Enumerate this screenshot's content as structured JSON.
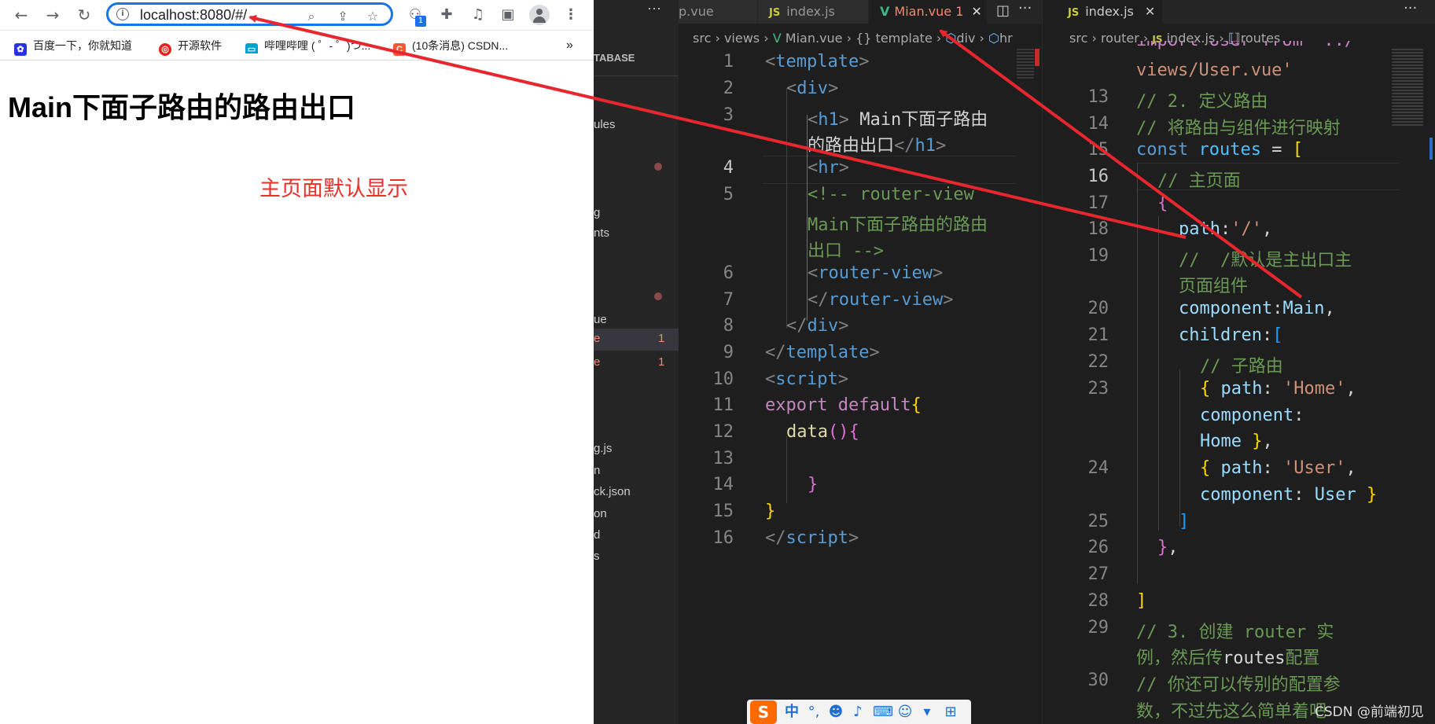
{
  "browser": {
    "url": "localhost:8080/#/",
    "bookmarks": [
      {
        "label": "百度一下，你就知道",
        "icon": "baidu-paw-icon",
        "color": "#2932e1"
      },
      {
        "label": "开源软件",
        "icon": "oschina-icon",
        "color": "#e2231a"
      },
      {
        "label": "哔哩哔哩 ( ゜- ゜)つ...",
        "icon": "bilibili-tv-icon",
        "color": "#00a1d6"
      },
      {
        "label": "(10条消息) CSDN...",
        "icon": "csdn-c-icon",
        "color": "#fc5531"
      }
    ],
    "more_bookmarks": "»",
    "extension_badge": "1",
    "page": {
      "heading": "Main下面子路由的路由出口",
      "default_text": "主页面默认显示"
    }
  },
  "explorer": {
    "header": "TABASE",
    "items": [
      {
        "label": "ules",
        "y": 0
      },
      {
        "label": "g",
        "y": 1
      },
      {
        "label": "nts",
        "y": 2
      },
      {
        "label": "ue",
        "y": 3
      },
      {
        "label": "e",
        "y": 4,
        "badge": "1"
      },
      {
        "label": "e",
        "y": 5,
        "badge": "1"
      },
      {
        "label": "g.js",
        "y": 6
      },
      {
        "label": "n",
        "y": 7
      },
      {
        "label": "ck.json",
        "y": 8
      },
      {
        "label": "on",
        "y": 9
      },
      {
        "label": "d",
        "y": 10
      },
      {
        "label": "s",
        "y": 11
      }
    ]
  },
  "editor1": {
    "tabs": [
      {
        "label": "p.vue"
      },
      {
        "label": "index.js",
        "icon": "JS"
      },
      {
        "label": "Mian.vue 1",
        "icon": "V",
        "active": true
      }
    ],
    "breadcrumb": [
      "src",
      "views",
      "Mian.vue",
      "template",
      "div",
      "hr"
    ],
    "lines": [
      {
        "n": "1"
      },
      {
        "n": "2"
      },
      {
        "n": "3"
      },
      {
        "n": ""
      },
      {
        "n": "4"
      },
      {
        "n": "5"
      },
      {
        "n": ""
      },
      {
        "n": ""
      },
      {
        "n": "6"
      },
      {
        "n": "7"
      },
      {
        "n": "8"
      },
      {
        "n": "9"
      },
      {
        "n": "10"
      },
      {
        "n": "11"
      },
      {
        "n": "12"
      },
      {
        "n": "13"
      },
      {
        "n": "14"
      },
      {
        "n": "15"
      },
      {
        "n": "16"
      }
    ]
  },
  "editor2": {
    "tabs": [
      {
        "label": "index.js",
        "icon": "JS"
      }
    ],
    "breadcrumb": [
      "src",
      "router",
      "index.js",
      "routes"
    ],
    "partial_top_line": "import User from '../",
    "lines": [
      {
        "n": ""
      },
      {
        "n": "13"
      },
      {
        "n": "14"
      },
      {
        "n": "15"
      },
      {
        "n": "16"
      },
      {
        "n": "17"
      },
      {
        "n": "18"
      },
      {
        "n": "19"
      },
      {
        "n": ""
      },
      {
        "n": "20"
      },
      {
        "n": "21"
      },
      {
        "n": "22"
      },
      {
        "n": "23"
      },
      {
        "n": ""
      },
      {
        "n": ""
      },
      {
        "n": "24"
      },
      {
        "n": ""
      },
      {
        "n": "25"
      },
      {
        "n": "26"
      },
      {
        "n": "27"
      },
      {
        "n": "28"
      },
      {
        "n": "29"
      },
      {
        "n": ""
      },
      {
        "n": "30"
      },
      {
        "n": ""
      }
    ]
  },
  "ime": {
    "label": "中"
  },
  "watermark": "CSDN @前端初见",
  "colors": {
    "annotation_arrow": "#e8262d",
    "focus_ring": "#1a73e8",
    "modified_tab": "#f48771"
  }
}
